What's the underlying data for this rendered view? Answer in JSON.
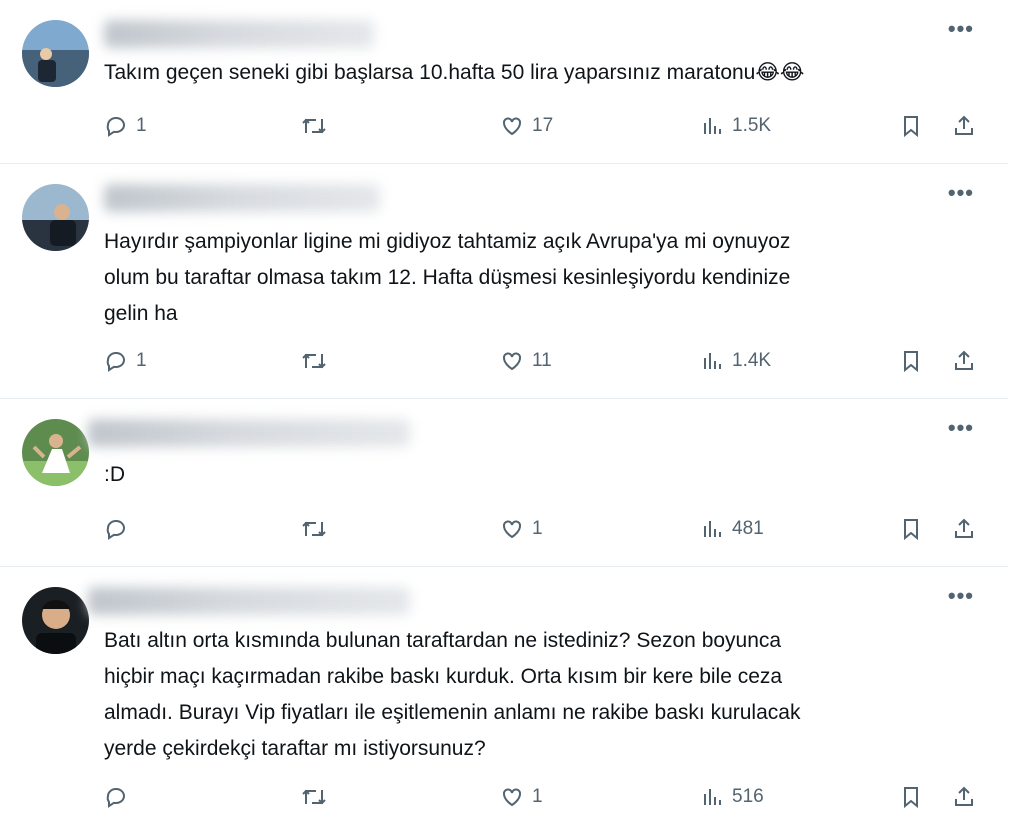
{
  "tweets": [
    {
      "text": "Takım geçen seneki gibi başlarsa 10.hafta 50 lira yaparsınız maratonu😂😂",
      "replies": "1",
      "likes": "17",
      "views": "1.5K"
    },
    {
      "text": "Hayırdır şampiyonlar ligine mi gidiyoz tahtamiz açık Avrupa'ya mi oynuyoz\nolum bu taraftar olmasa takım 12. Hafta düşmesi kesinleşiyordu kendinize\ngelin ha",
      "replies": "1",
      "likes": "11",
      "views": "1.4K"
    },
    {
      "text": ":D",
      "replies": "",
      "likes": "1",
      "views": "481"
    },
    {
      "text": "Batı altın orta kısmında bulunan taraftardan ne istediniz? Sezon boyunca\nhiçbir maçı kaçırmadan rakibe baskı kurduk. Orta kısım bir kere bile ceza\nalmadı. Burayı Vip fiyatları ile eşitlemenin anlamı ne rakibe baskı kurulacak\nyerde çekirdekçi taraftar mı istiyorsunuz?",
      "replies": "",
      "likes": "1",
      "views": "516"
    }
  ],
  "icons": {
    "reply": "reply-icon",
    "retweet": "retweet-icon",
    "like": "heart-icon",
    "views": "views-icon",
    "bookmark": "bookmark-icon",
    "share": "share-icon",
    "more": "more-icon"
  },
  "more_glyph": "•••",
  "colors": {
    "icon": "#536471",
    "text": "#0f1419",
    "divider": "#e6ecf0"
  }
}
